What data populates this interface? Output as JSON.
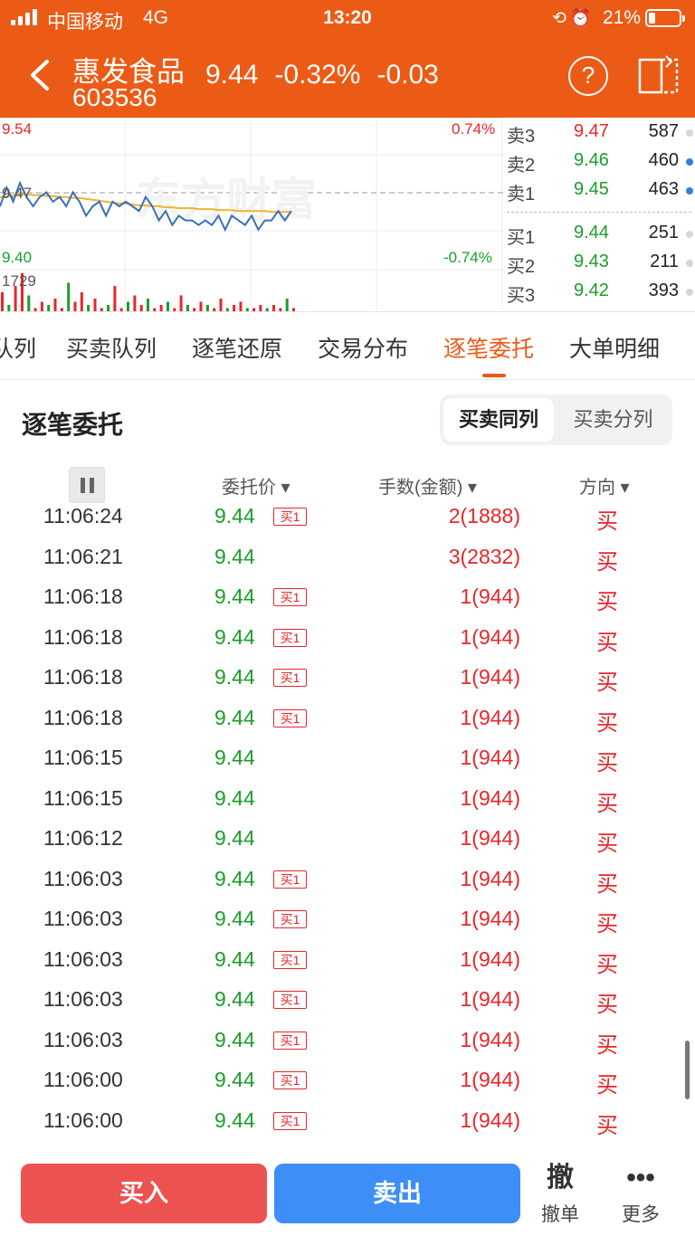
{
  "status_bar": {
    "carrier": "中国移动",
    "network": "4G",
    "time": "13:20",
    "battery": "21%",
    "battery_level": 0.21
  },
  "header": {
    "name": "惠发食品",
    "code": "603536",
    "price": "9.44",
    "change_pct": "-0.32%",
    "change": "-0.03",
    "help_icon": "question-circle-icon",
    "switch_icon": "screen-switch-icon"
  },
  "chart": {
    "high_label": "9.54",
    "mid_label": "9.47",
    "low_label": "9.40",
    "high_pct": "0.74%",
    "low_pct": "-0.74%",
    "volume_max": "1729",
    "watermark": "东方财富",
    "price_line": [
      9.455,
      9.475,
      9.46,
      9.48,
      9.465,
      9.455,
      9.465,
      9.47,
      9.46,
      9.465,
      9.455,
      9.47,
      9.46,
      9.445,
      9.455,
      9.46,
      9.445,
      9.46,
      9.455,
      9.46,
      9.455,
      9.45,
      9.465,
      9.455,
      9.44,
      9.45,
      9.435,
      9.445,
      9.44,
      9.44,
      9.435,
      9.44,
      9.435,
      9.445,
      9.43,
      9.445,
      9.44,
      9.435,
      9.445,
      9.43,
      9.44,
      9.44,
      9.45,
      9.44,
      9.45
    ],
    "avg_line": [
      9.465,
      9.466,
      9.467,
      9.468,
      9.468,
      9.467,
      9.467,
      9.466,
      9.466,
      9.465,
      9.465,
      9.464,
      9.464,
      9.463,
      9.462,
      9.461,
      9.46,
      9.459,
      9.458,
      9.458,
      9.457,
      9.456,
      9.456,
      9.455,
      9.455,
      9.454,
      9.454,
      9.453,
      9.453,
      9.453,
      9.452,
      9.452,
      9.452,
      9.451,
      9.451,
      9.451,
      9.45,
      9.45,
      9.45,
      9.45,
      9.45,
      9.449,
      9.449,
      9.449,
      9.449
    ],
    "volumes": [
      6,
      2,
      8,
      12,
      5,
      1,
      3,
      2,
      4,
      1,
      9,
      3,
      6,
      2,
      4,
      1,
      2,
      8,
      1,
      3,
      5,
      2,
      4,
      1,
      2,
      3,
      1,
      5,
      2,
      1,
      3,
      2,
      1,
      4,
      1,
      2,
      3,
      1,
      1,
      2,
      1,
      2,
      1,
      4,
      1
    ]
  },
  "order_book": {
    "asks": [
      {
        "label": "卖3",
        "price": "9.47",
        "volume": "587",
        "dot": "#d6d6d6"
      },
      {
        "label": "卖2",
        "price": "9.46",
        "volume": "460",
        "dot": "#3a7be0"
      },
      {
        "label": "卖1",
        "price": "9.45",
        "volume": "463",
        "dot": "#3a7be0"
      }
    ],
    "bids": [
      {
        "label": "买1",
        "price": "9.44",
        "volume": "251",
        "dot": "#d6d6d6"
      },
      {
        "label": "买2",
        "price": "9.43",
        "volume": "211",
        "dot": "#d6d6d6"
      },
      {
        "label": "买3",
        "price": "9.42",
        "volume": "393",
        "dot": "#d6d6d6"
      }
    ]
  },
  "tabs": [
    "队列",
    "买卖队列",
    "逐笔还原",
    "交易分布",
    "逐笔委托",
    "大单明细"
  ],
  "active_tab": "逐笔委托",
  "section": {
    "title": "逐笔委托",
    "seg_active": "买卖同列",
    "seg_other": "买卖分列"
  },
  "columns": {
    "price": "委托价",
    "qty": "手数(金额)",
    "direction": "方向"
  },
  "rows": [
    {
      "time": "11:06:24",
      "price": "9.44",
      "tag": "买1",
      "qty": "2(1888)",
      "dir": "买"
    },
    {
      "time": "11:06:21",
      "price": "9.44",
      "tag": "",
      "qty": "3(2832)",
      "dir": "买"
    },
    {
      "time": "11:06:18",
      "price": "9.44",
      "tag": "买1",
      "qty": "1(944)",
      "dir": "买"
    },
    {
      "time": "11:06:18",
      "price": "9.44",
      "tag": "买1",
      "qty": "1(944)",
      "dir": "买"
    },
    {
      "time": "11:06:18",
      "price": "9.44",
      "tag": "买1",
      "qty": "1(944)",
      "dir": "买"
    },
    {
      "time": "11:06:18",
      "price": "9.44",
      "tag": "买1",
      "qty": "1(944)",
      "dir": "买"
    },
    {
      "time": "11:06:15",
      "price": "9.44",
      "tag": "",
      "qty": "1(944)",
      "dir": "买"
    },
    {
      "time": "11:06:15",
      "price": "9.44",
      "tag": "",
      "qty": "1(944)",
      "dir": "买"
    },
    {
      "time": "11:06:12",
      "price": "9.44",
      "tag": "",
      "qty": "1(944)",
      "dir": "买"
    },
    {
      "time": "11:06:03",
      "price": "9.44",
      "tag": "买1",
      "qty": "1(944)",
      "dir": "买"
    },
    {
      "time": "11:06:03",
      "price": "9.44",
      "tag": "买1",
      "qty": "1(944)",
      "dir": "买"
    },
    {
      "time": "11:06:03",
      "price": "9.44",
      "tag": "买1",
      "qty": "1(944)",
      "dir": "买"
    },
    {
      "time": "11:06:03",
      "price": "9.44",
      "tag": "买1",
      "qty": "1(944)",
      "dir": "买"
    },
    {
      "time": "11:06:03",
      "price": "9.44",
      "tag": "买1",
      "qty": "1(944)",
      "dir": "买"
    },
    {
      "time": "11:06:00",
      "price": "9.44",
      "tag": "买1",
      "qty": "1(944)",
      "dir": "买"
    },
    {
      "time": "11:06:00",
      "price": "9.44",
      "tag": "买1",
      "qty": "1(944)",
      "dir": "买"
    }
  ],
  "bottom": {
    "buy": "买入",
    "sell": "卖出",
    "cancel_icon": "撤",
    "cancel_label": "撤单",
    "more_icon": "•••",
    "more_label": "更多"
  },
  "colors": {
    "brand": "#ec5b16",
    "up": "#e8262b",
    "down": "#1a9e2a",
    "price_line": "#3a6fb8",
    "avg_line": "#f0b232",
    "buy_button": "#ec5350",
    "sell_button": "#3d8ef7"
  }
}
